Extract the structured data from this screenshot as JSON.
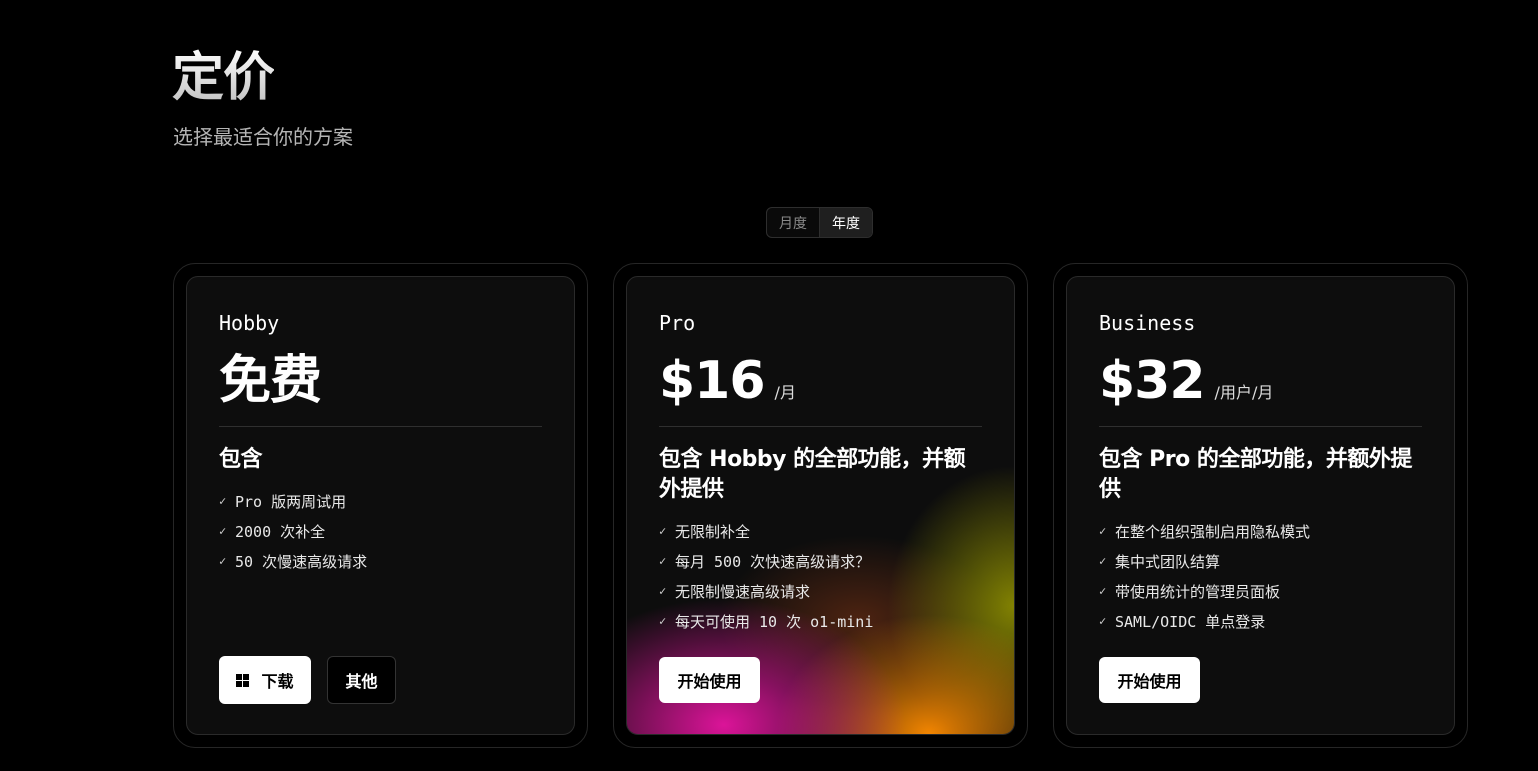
{
  "header": {
    "title": "定价",
    "subtitle": "选择最适合你的方案"
  },
  "billing_toggle": {
    "options": [
      "月度",
      "年度"
    ],
    "selected": "年度"
  },
  "plans": [
    {
      "name": "Hobby",
      "price": "免费",
      "period": "",
      "includes": "包含",
      "features": [
        "Pro 版两周试用",
        "2000 次补全",
        "50 次慢速高级请求"
      ],
      "buttons": [
        {
          "label": "下载",
          "icon": "windows-icon",
          "style": "white"
        },
        {
          "label": "其他",
          "style": "dark"
        }
      ]
    },
    {
      "name": "Pro",
      "price": "$16",
      "period": "/月",
      "includes": "包含 Hobby 的全部功能，并额外提供",
      "features": [
        "无限制补全",
        "每月 500 次快速高级请求？",
        "无限制慢速高级请求",
        "每天可使用 10 次 o1-mini"
      ],
      "buttons": [
        {
          "label": "开始使用",
          "style": "white"
        }
      ],
      "accent_colors": [
        "#e614a0",
        "#ff8c00",
        "#969600"
      ]
    },
    {
      "name": "Business",
      "price": "$32",
      "period": "/用户/月",
      "includes": "包含 Pro 的全部功能，并额外提供",
      "features": [
        "在整个组织强制启用隐私模式",
        "集中式团队结算",
        "带使用统计的管理员面板",
        "SAML/OIDC 单点登录"
      ],
      "buttons": [
        {
          "label": "开始使用",
          "style": "white"
        }
      ]
    }
  ]
}
